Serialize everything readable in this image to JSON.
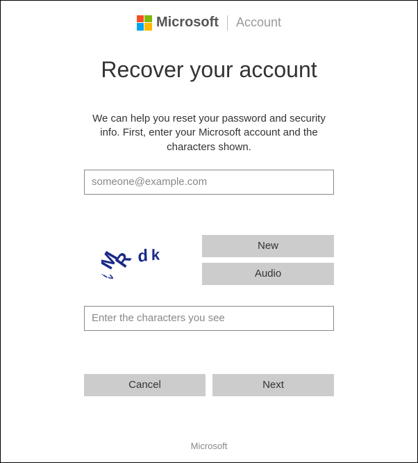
{
  "header": {
    "brand": "Microsoft",
    "section": "Account"
  },
  "main": {
    "title": "Recover your account",
    "description": "We can help you reset your password and security info. First, enter your Microsoft account and the characters shown.",
    "email_placeholder": "someone@example.com",
    "captcha_text": "MRdk",
    "new_label": "New",
    "audio_label": "Audio",
    "captcha_input_placeholder": "Enter the characters you see",
    "cancel_label": "Cancel",
    "next_label": "Next"
  },
  "footer": {
    "brand": "Microsoft"
  }
}
